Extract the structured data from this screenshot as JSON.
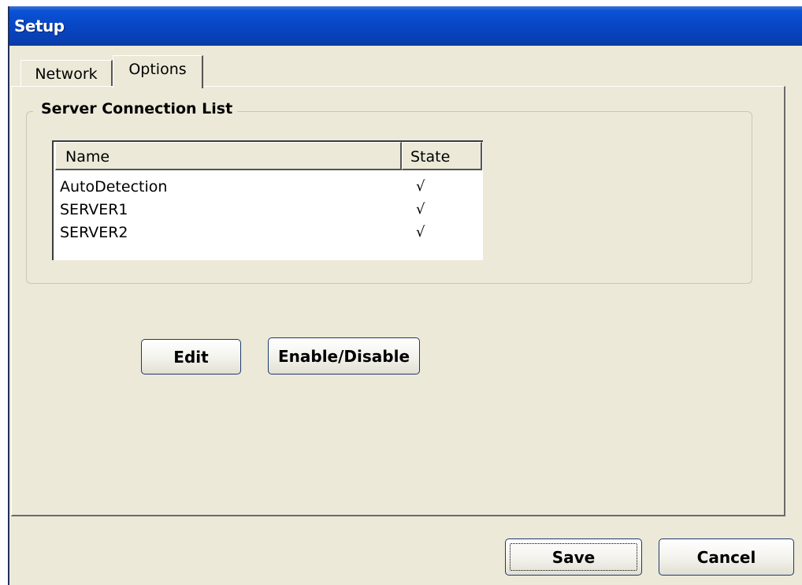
{
  "window": {
    "title": "Setup"
  },
  "tabs": [
    {
      "label": "Network",
      "selected": false
    },
    {
      "label": "Options",
      "selected": true
    }
  ],
  "server_list": {
    "group_label": "Server Connection List",
    "columns": [
      "Name",
      "State"
    ],
    "rows": [
      {
        "name": "AutoDetection",
        "state": "√"
      },
      {
        "name": "SERVER1",
        "state": "√"
      },
      {
        "name": "SERVER2",
        "state": "√"
      }
    ]
  },
  "actions": {
    "edit_label": "Edit",
    "enable_disable_label": "Enable/Disable"
  },
  "footer": {
    "save_label": "Save",
    "cancel_label": "Cancel"
  },
  "colors": {
    "title_bar": "#0846c4",
    "dialog_background": "#ece9d8",
    "button_border": "#1b3a6e"
  }
}
